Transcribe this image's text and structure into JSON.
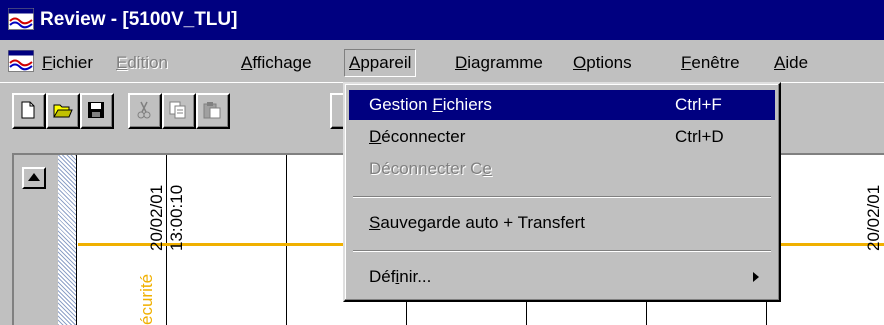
{
  "window": {
    "title": "Review - [5100V_TLU]",
    "app_icon": "review-app-icon"
  },
  "menubar": {
    "items": [
      {
        "label": "Fichier",
        "mnemonic": "F",
        "state": "normal"
      },
      {
        "label": "Edition",
        "mnemonic": "E",
        "state": "disabled"
      },
      {
        "label": "Affichage",
        "mnemonic": "A",
        "state": "normal"
      },
      {
        "label": "Appareil",
        "mnemonic": "A",
        "state": "open"
      },
      {
        "label": "Diagramme",
        "mnemonic": "D",
        "state": "normal"
      },
      {
        "label": "Options",
        "mnemonic": "O",
        "state": "normal"
      },
      {
        "label": "Fenêtre",
        "mnemonic": "F",
        "state": "normal"
      },
      {
        "label": "Aide",
        "mnemonic": "A",
        "state": "normal"
      }
    ]
  },
  "toolbar": {
    "buttons": [
      {
        "name": "new-document-icon"
      },
      {
        "name": "open-folder-icon"
      },
      {
        "name": "save-icon"
      },
      {
        "name": "cut-icon"
      },
      {
        "name": "copy-icon"
      },
      {
        "name": "paste-icon"
      }
    ]
  },
  "dropdown": {
    "items": [
      {
        "label": "Gestion Fichiers",
        "shortcut": "Ctrl+F",
        "state": "selected"
      },
      {
        "label": "Déconnecter",
        "shortcut": "Ctrl+D",
        "state": "normal"
      },
      {
        "label": "Déconnecter Ce",
        "shortcut": "",
        "state": "disabled"
      },
      {
        "label": "Sauvegarde auto + Transfert",
        "shortcut": "",
        "state": "normal"
      },
      {
        "label": "Définir...",
        "shortcut": "",
        "state": "normal",
        "submenu": true
      }
    ]
  },
  "chart": {
    "timestamp_left": {
      "date": "20/02/01",
      "time": "13:00:10"
    },
    "timestamp_right": {
      "date": "20/02/01"
    },
    "series_label": "écurité",
    "series_color": "#f0b000"
  },
  "colors": {
    "titlebar": "#000080",
    "highlight": "#000080",
    "face": "#c0c0c0"
  }
}
